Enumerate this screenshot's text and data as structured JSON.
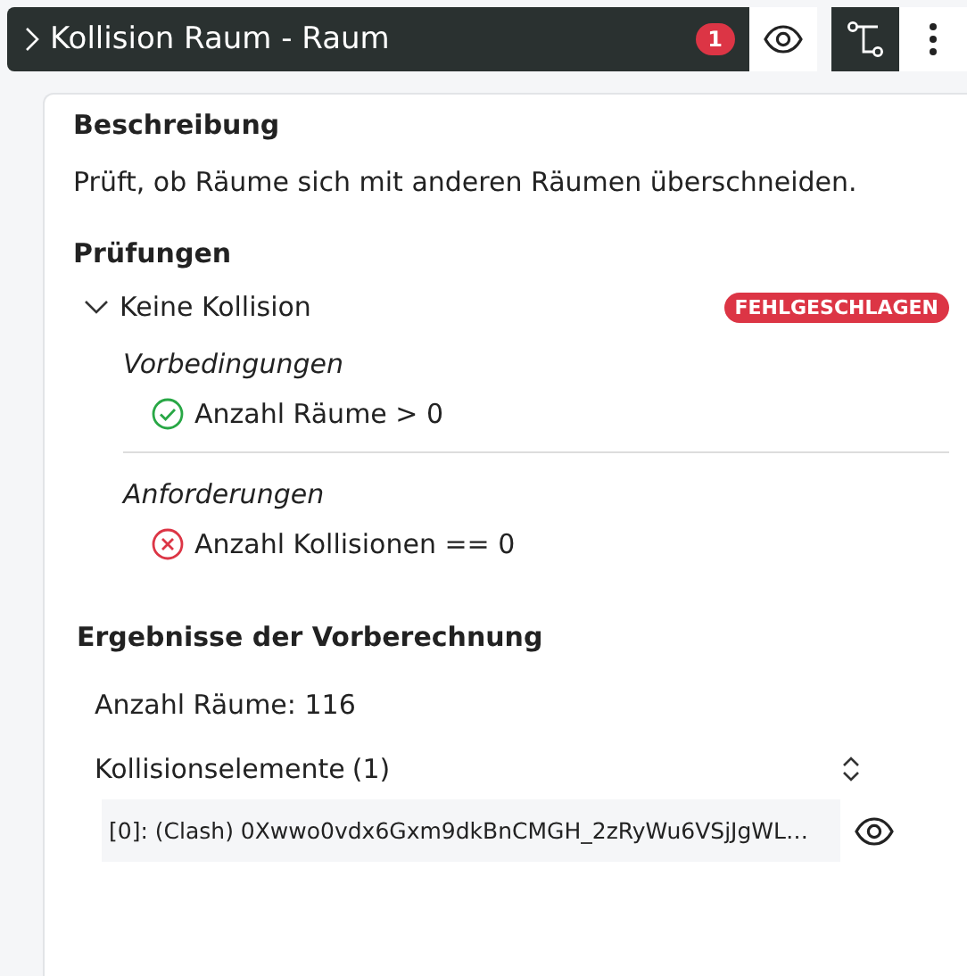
{
  "header": {
    "title": "Kollision Raum - Raum",
    "expanded": false,
    "badge": "1"
  },
  "description": {
    "heading": "Beschreibung",
    "text": "Prüft, ob Räume sich mit anderen Räumen überschneiden."
  },
  "checks": {
    "heading": "Prüfungen",
    "items": [
      {
        "label": "Keine Kollision",
        "expanded": true,
        "status": "FEHLGESCHLAGEN",
        "kind": "failed",
        "groups": [
          {
            "title": "Vorbedingungen",
            "conditions": [
              {
                "label": "Anzahl Räume > 0",
                "kind": "passed"
              }
            ]
          },
          {
            "title": "Anforderungen",
            "conditions": [
              {
                "label": "Anzahl Kollisionen == 0",
                "kind": "failed"
              }
            ]
          }
        ]
      }
    ]
  },
  "precalc": {
    "heading": "Ergebnisse der Vorberechnung",
    "count_text": "Anzahl Räume: 116",
    "list_label": "Kollisionselemente",
    "list_count": "(1)",
    "elements": [
      {
        "text": "[0]: (Clash) 0Xwwo0vdx6Gxm9dkBnCMGH_2zRyWu6VSjJgWL…"
      }
    ]
  }
}
